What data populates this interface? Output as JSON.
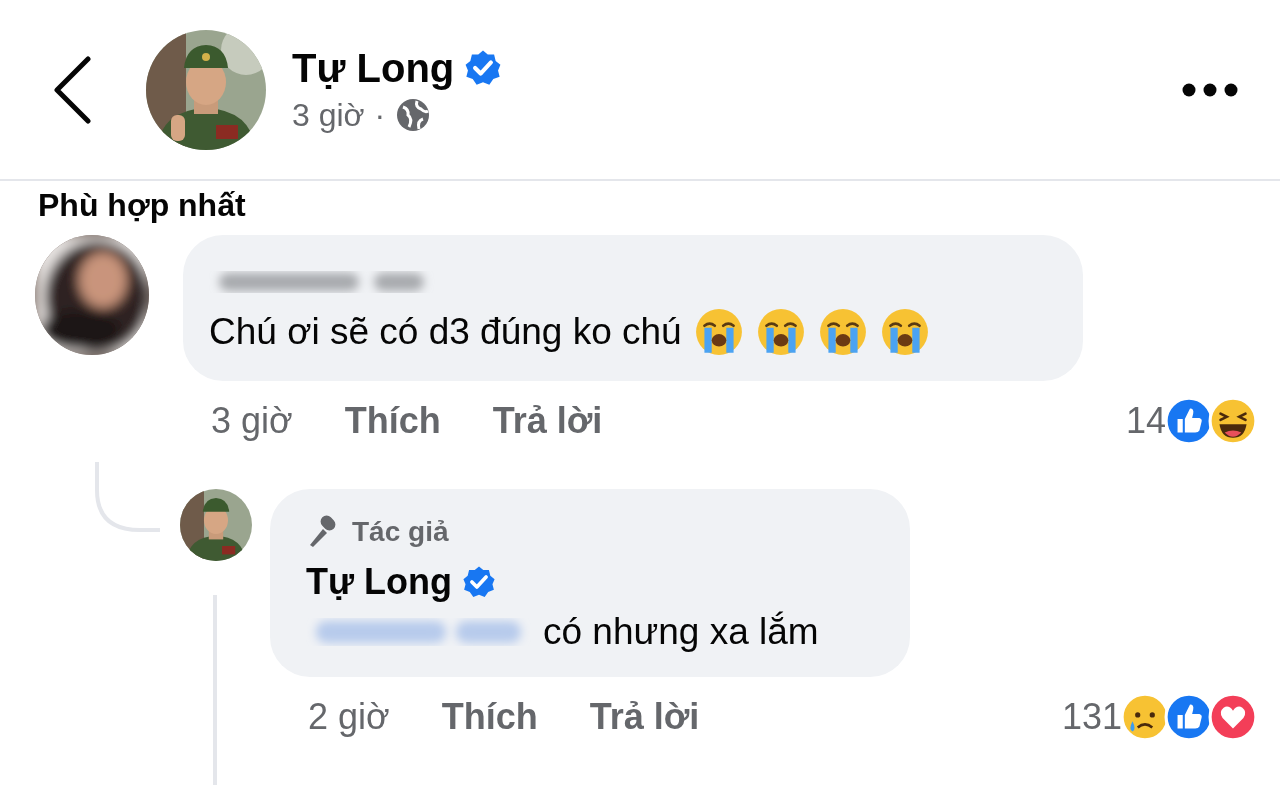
{
  "post_header": {
    "author": "Tự Long",
    "verified": true,
    "time": "3 giờ",
    "separator": "·"
  },
  "sort_label": "Phù hợp nhất",
  "comment": {
    "text": "Chú ơi sẽ có d3 đúng ko chú",
    "emojis": [
      {
        "kind": "crying"
      },
      {
        "kind": "crying"
      },
      {
        "kind": "crying"
      },
      {
        "kind": "crying"
      }
    ],
    "time": "3 giờ",
    "like_label": "Thích",
    "reply_label": "Trả lời",
    "reaction_count": "14",
    "reactions": [
      {
        "kind": "like"
      },
      {
        "kind": "haha"
      }
    ]
  },
  "reply": {
    "badge": "Tác giả",
    "author": "Tự Long",
    "verified": true,
    "text": "có nhưng xa lắm",
    "time": "2 giờ",
    "like_label": "Thích",
    "reply_label": "Trả lời",
    "reaction_count": "131",
    "reactions": [
      {
        "kind": "sad"
      },
      {
        "kind": "like"
      },
      {
        "kind": "love"
      }
    ]
  }
}
